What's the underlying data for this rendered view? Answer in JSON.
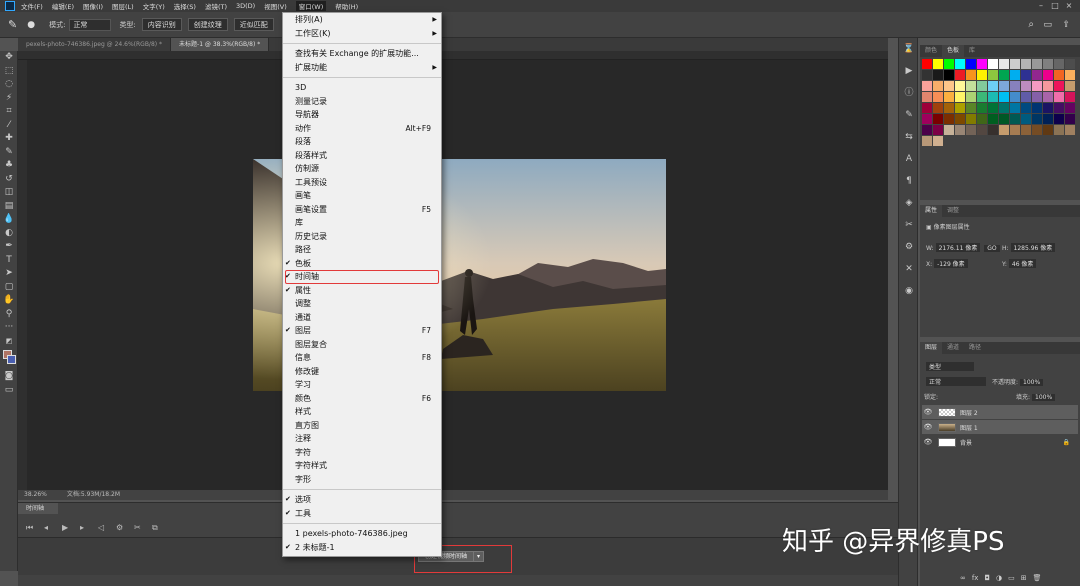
{
  "menubar": {
    "items": [
      "文件(F)",
      "编辑(E)",
      "图像(I)",
      "图层(L)",
      "文字(Y)",
      "选择(S)",
      "滤镜(T)",
      "3D(D)",
      "视图(V)",
      "窗口(W)",
      "帮助(H)"
    ],
    "active_index": 9
  },
  "options": {
    "mode_label": "模式:",
    "mode_value": "正常",
    "type_label": "类型:",
    "btn1": "内容识别",
    "btn2": "创建纹理",
    "btn3": "近似匹配"
  },
  "tabs": [
    {
      "label": "pexels-photo-746386.jpeg @ 24.6%(RGB/8) *",
      "active": false
    },
    {
      "label": "未标题-1 @ 38.3%(RGB/8) *",
      "active": true
    }
  ],
  "window_menu": {
    "items": [
      {
        "label": "排列(A)",
        "submenu": true
      },
      {
        "label": "工作区(K)",
        "submenu": true
      },
      {
        "sep": true
      },
      {
        "label": "查找有关 Exchange 的扩展功能..."
      },
      {
        "label": "扩展功能",
        "submenu": true
      },
      {
        "sep": true
      },
      {
        "label": "3D"
      },
      {
        "label": "测量记录"
      },
      {
        "label": "导航器"
      },
      {
        "label": "动作",
        "shortcut": "Alt+F9"
      },
      {
        "label": "段落"
      },
      {
        "label": "段落样式"
      },
      {
        "label": "仿制源"
      },
      {
        "label": "工具预设"
      },
      {
        "label": "画笔"
      },
      {
        "label": "画笔设置",
        "shortcut": "F5"
      },
      {
        "label": "库"
      },
      {
        "label": "历史记录"
      },
      {
        "label": "路径"
      },
      {
        "label": "色板",
        "checked": true
      },
      {
        "label": "时间轴",
        "checked": true,
        "highlighted": true
      },
      {
        "label": "属性",
        "checked": true
      },
      {
        "label": "调整"
      },
      {
        "label": "通道"
      },
      {
        "label": "图层",
        "checked": true,
        "shortcut": "F7"
      },
      {
        "label": "图层复合"
      },
      {
        "label": "信息",
        "shortcut": "F8"
      },
      {
        "label": "修改键"
      },
      {
        "label": "学习"
      },
      {
        "label": "颜色",
        "shortcut": "F6"
      },
      {
        "label": "样式"
      },
      {
        "label": "直方图"
      },
      {
        "label": "注释"
      },
      {
        "label": "字符"
      },
      {
        "label": "字符样式"
      },
      {
        "label": "字形"
      },
      {
        "sep": true
      },
      {
        "label": "选项",
        "checked": true
      },
      {
        "label": "工具",
        "checked": true
      },
      {
        "sep": true
      },
      {
        "label": "1 pexels-photo-746386.jpeg"
      },
      {
        "label": "2 未标题-1",
        "checked": true
      }
    ]
  },
  "status": {
    "zoom": "38.26%",
    "doc": "文档:5.93M/18.2M"
  },
  "timeline": {
    "tab": "时间轴",
    "create_button": "创建视频时间轴"
  },
  "swatches_panel": {
    "tabs": [
      "颜色",
      "色板",
      "库"
    ],
    "active": 1,
    "colors": [
      "#ff0000",
      "#ffff00",
      "#00ff00",
      "#00ffff",
      "#0000ff",
      "#ff00ff",
      "#ffffff",
      "#e6e6e6",
      "#cccccc",
      "#b3b3b3",
      "#999999",
      "#808080",
      "#666666",
      "#4d4d4d",
      "#333333",
      "#1a1a1a",
      "#000000",
      "#ed1c24",
      "#f7941d",
      "#fff200",
      "#8dc63f",
      "#00a651",
      "#00aeef",
      "#2e3192",
      "#92278f",
      "#ec008c",
      "#f26522",
      "#fbaf5d",
      "#f9a19a",
      "#f7ad6a",
      "#fdc68a",
      "#fff799",
      "#c4df9b",
      "#82ca9c",
      "#6dcff6",
      "#7da7d9",
      "#8781bd",
      "#bd8cbf",
      "#f49ac1",
      "#f5989d",
      "#ed145b",
      "#c69c6d",
      "#e2856e",
      "#f68e56",
      "#fbb040",
      "#fff568",
      "#acd373",
      "#3cb878",
      "#1cbbb4",
      "#00bff3",
      "#448ccb",
      "#605ca8",
      "#8560a8",
      "#a864a8",
      "#f06eaa",
      "#d4145a",
      "#9e0039",
      "#a0410d",
      "#a36209",
      "#aba000",
      "#598527",
      "#197b30",
      "#007236",
      "#00746b",
      "#0076a3",
      "#004a80",
      "#003471",
      "#1b1464",
      "#440e62",
      "#630460",
      "#9e005d",
      "#790000",
      "#7b2e00",
      "#7d4900",
      "#827b00",
      "#406618",
      "#005e20",
      "#005826",
      "#005952",
      "#005b7f",
      "#003663",
      "#002157",
      "#0d004c",
      "#32004b",
      "#4b0049",
      "#7b0046",
      "#c7b299",
      "#998675",
      "#736357",
      "#534741",
      "#37302d",
      "#c69c6d",
      "#a67c52",
      "#8c6239",
      "#754c24",
      "#603913",
      "#8b7355",
      "#a08060",
      "#b89878",
      "#d0b090"
    ]
  },
  "properties_panel": {
    "tabs": [
      "属性",
      "调整"
    ],
    "title": "像素图层属性",
    "w_label": "W:",
    "w_value": "2176.11 像素",
    "go_label": "GO",
    "h_label": "H:",
    "h_value": "1285.96 像素",
    "x_label": "X:",
    "x_value": "-129 像素",
    "y_label": "Y:",
    "y_value": "46 像素"
  },
  "layers_panel": {
    "tabs": [
      "图层",
      "通道",
      "路径"
    ],
    "kind": "类型",
    "blend": "正常",
    "opacity_label": "不透明度:",
    "opacity": "100%",
    "lock_label": "锁定:",
    "fill_label": "填充:",
    "fill": "100%",
    "layers": [
      {
        "name": "图层 2",
        "selected": true
      },
      {
        "name": "图层 1",
        "selected": true
      },
      {
        "name": "背景",
        "selected": false
      }
    ]
  },
  "watermark": "知乎 @异界修真PS"
}
